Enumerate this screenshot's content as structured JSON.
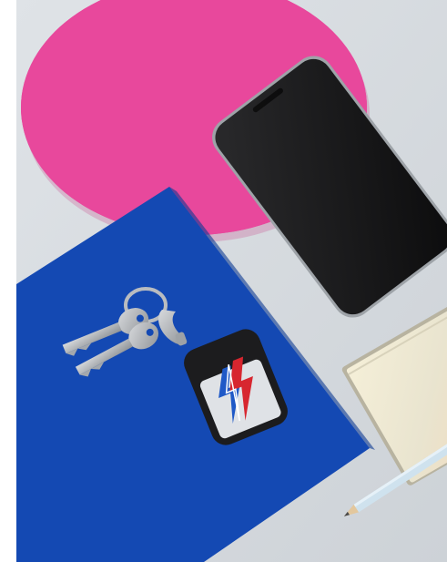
{
  "scene": {
    "kind": "flat-lay-photo",
    "objects": [
      "pink-circle",
      "smartphone",
      "blue-paper-sheet",
      "keys",
      "key-fob-with-lightning-bolt",
      "notepad",
      "pencil"
    ],
    "colors": {
      "background": "#d5d9de",
      "pink": "#e8489c",
      "blue": "#1449b3",
      "phone": "#141414",
      "fob_body": "#1c1c1e",
      "fob_panel": "#dfe2e6",
      "bolt_red": "#d7262f",
      "bolt_blue": "#1f59c7",
      "key_metal": "#b9bcc0",
      "notepad": "#f1ead0",
      "pencil": "#cfe2ee"
    }
  }
}
